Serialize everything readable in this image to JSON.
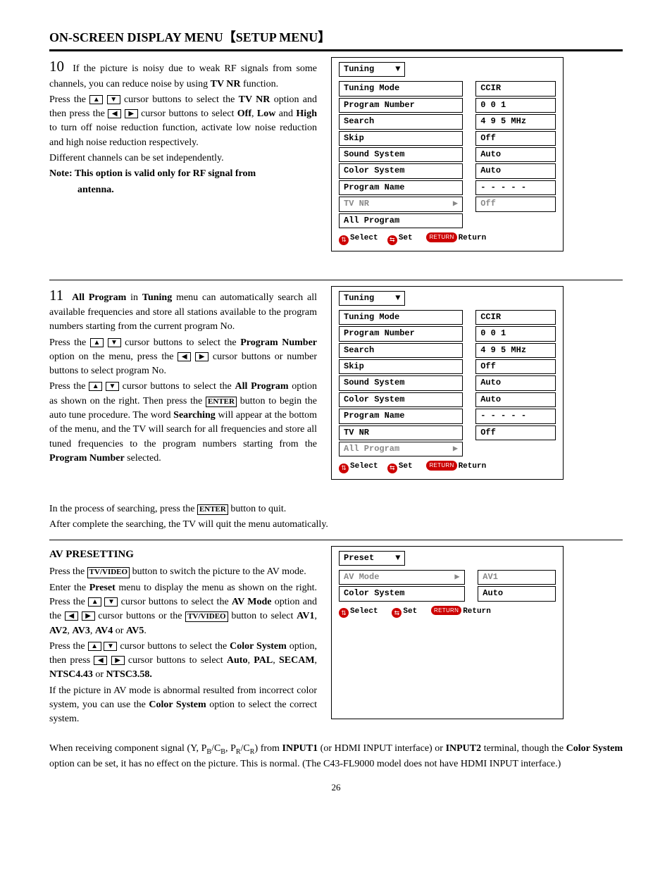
{
  "page_number": "26",
  "heading_a": "ON-SCREEN DISPLAY MENU",
  "heading_b": "SETUP MENU",
  "s10": {
    "num": "10",
    "p1a": "If the picture is noisy due to weak RF signals from some channels, you can reduce noise by using ",
    "p1b": "TV NR",
    "p1c": " function.",
    "p2a": "Press the ",
    "p2b": " cursor buttons to select the ",
    "p2c": "TV NR",
    "p2d": " option and then press the ",
    "p2e": " cursor buttons to select ",
    "p2f": "Off",
    "p2g": "Low",
    "p2h": "High",
    "p2i": " to turn off noise reduction function, activate low noise reduction and high noise reduction respectively.",
    "p3": "Different channels can be set independently.",
    "p4a": "Note: This option is valid only for RF signal from antenna.",
    "p4b": "antenna."
  },
  "s11": {
    "num": "11",
    "p1a": "All Program",
    "p1b": " in ",
    "p1c": "Tuning",
    "p1d": " menu can automatically search all available frequencies and store all stations available to the program numbers starting from the current program No.",
    "p2a": "Press the ",
    "p2b": " cursor buttons to select the ",
    "p2c": "Program Number",
    "p2d": " option on the menu, press the ",
    "p2e": " cursor buttons or number buttons to select program No.",
    "p3a": "Press the ",
    "p3b": " cursor buttons to select the ",
    "p3c": "All Program",
    "p3d": " option as shown on the right. Then press the ",
    "p3e": "ENTER",
    "p3f": " button to begin the auto tune procedure. The word ",
    "p3g": "Searching",
    "p3h": " will appear at the bottom of the menu, and the TV will search for all frequencies and store all tuned frequencies to the program numbers starting from the ",
    "p3i": "Program Number",
    "p3j": " selected.",
    "p4a": "In the process of searching, press the ",
    "p4b": "ENTER",
    "p4c": " button to quit.",
    "p5": "After complete the searching, the TV will quit the menu automatically."
  },
  "av": {
    "head": "AV PRESETTING",
    "p1a": "Press the ",
    "p1b": "TV/VIDEO",
    "p1c": " button to switch the picture to the AV mode.",
    "p2a": "Enter the ",
    "p2b": "Preset",
    "p2c": " menu to display the menu as shown on the right. Press the ",
    "p2d": " cursor buttons to select the ",
    "p2e": "AV Mode",
    "p2f": " option and the ",
    "p2g": " cursor buttons or the ",
    "p2h": "TV/VIDEO",
    "p2i": " button to select ",
    "p2j": "AV1",
    "p2k": "AV2",
    "p2l": "AV3",
    "p2m": "AV4",
    "p2n": "AV5",
    "p3a": "Press the ",
    "p3b": " cursor buttons to select the ",
    "p3c": "Color System",
    "p3d": " option, then press ",
    "p3e": " cursor buttons to select ",
    "p3f": "Auto",
    "p3g": "PAL",
    "p3h": "SECAM",
    "p3i": "NTSC4.43",
    "p3j": "NTSC3.58.",
    "p4": "If the picture in AV mode is abnormal resulted from incorrect color system, you can use the ",
    "p4b": "Color System",
    "p4c": " option to select the correct system.",
    "p5a": "When receiving component signal (Y, P",
    "p5a2": "B",
    "p5a3": "/C",
    "p5a4": "B",
    "p5a5": ", P",
    "p5a6": "R",
    "p5a7": "/C",
    "p5a8": "R",
    "p5a9": ") from ",
    "p5b": "INPUT1",
    "p5c": " (or HDMI INPUT interface) or ",
    "p5d": "INPUT2",
    "p5e": " terminal, though the ",
    "p5f": "Color System",
    "p5g": " option can be set, it has no effect on the picture. This is normal. (The C43-FL9000 model does not have HDMI INPUT interface.)"
  },
  "osd1": {
    "title": "Tuning",
    "rows": [
      {
        "label": "Tuning Mode",
        "value": "CCIR"
      },
      {
        "label": "Program Number",
        "value": "0 0 1"
      },
      {
        "label": "Search",
        "value": "4 9 5 MHz"
      },
      {
        "label": "Skip",
        "value": "Off"
      },
      {
        "label": "Sound System",
        "value": "Auto"
      },
      {
        "label": "Color System",
        "value": "Auto"
      },
      {
        "label": "Program Name",
        "value": "- - - - -"
      },
      {
        "label": "TV NR",
        "value": "Off",
        "sel": true,
        "arrow": true
      },
      {
        "label": "All Program",
        "value": "",
        "noval": true
      }
    ],
    "foot_select": "Select",
    "foot_set": "Set",
    "foot_return": "Return",
    "foot_return_pill": "RETURN"
  },
  "osd2": {
    "title": "Tuning",
    "rows": [
      {
        "label": "Tuning Mode",
        "value": "CCIR"
      },
      {
        "label": "Program Number",
        "value": "0 0 1"
      },
      {
        "label": "Search",
        "value": "4 9 5 MHz"
      },
      {
        "label": "Skip",
        "value": "Off"
      },
      {
        "label": "Sound System",
        "value": "Auto"
      },
      {
        "label": "Color System",
        "value": "Auto"
      },
      {
        "label": "Program Name",
        "value": "- - - - -"
      },
      {
        "label": "TV NR",
        "value": "Off"
      },
      {
        "label": "All Program",
        "value": "",
        "noval": true,
        "sel": true,
        "arrow": true
      }
    ],
    "foot_select": "Select",
    "foot_set": "Set",
    "foot_return": "Return",
    "foot_return_pill": "RETURN"
  },
  "osd3": {
    "title": "Preset",
    "rows": [
      {
        "label": "AV Mode",
        "value": "AV1",
        "sel": true,
        "arrow": true
      },
      {
        "label": "Color System",
        "value": "Auto"
      }
    ],
    "foot_select": "Select",
    "foot_set": "Set",
    "foot_return": "Return",
    "foot_return_pill": "RETURN"
  }
}
